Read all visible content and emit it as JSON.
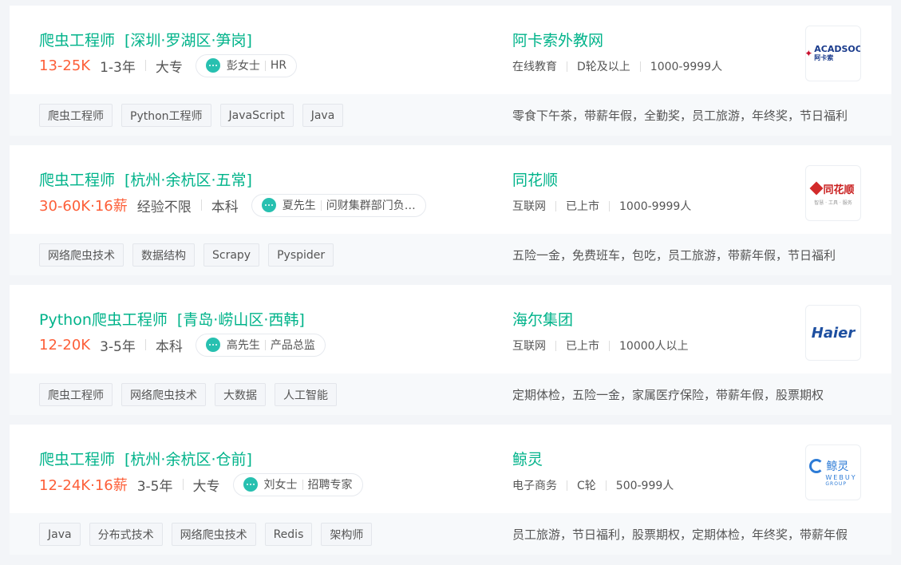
{
  "jobs": [
    {
      "title": "爬虫工程师",
      "location": "[深圳·罗湖区·笋岗]",
      "salary": "13-25K",
      "experience": "1-3年",
      "education": "大专",
      "hr_name": "彭女士",
      "hr_title": "HR",
      "company": "阿卡索外教网",
      "industry": "在线教育",
      "stage": "D轮及以上",
      "size": "1000-9999人",
      "logo": {
        "text": "ACADSOC",
        "sub": "阿卡索"
      },
      "tags": [
        "爬虫工程师",
        "Python工程师",
        "JavaScript",
        "Java"
      ],
      "benefits": "零食下午茶，带薪年假，全勤奖，员工旅游，年终奖，节日福利"
    },
    {
      "title": "爬虫工程师",
      "location": "[杭州·余杭区·五常]",
      "salary": "30-60K·16薪",
      "experience": "经验不限",
      "education": "本科",
      "hr_name": "夏先生",
      "hr_title": "问财集群部门负责人",
      "company": "同花顺",
      "industry": "互联网",
      "stage": "已上市",
      "size": "1000-9999人",
      "logo": {
        "text": "同花顺",
        "sub": "智慧 · 工具 · 服务"
      },
      "tags": [
        "网络爬虫技术",
        "数据结构",
        "Scrapy",
        "Pyspider"
      ],
      "benefits": "五险一金，免费班车，包吃，员工旅游，带薪年假，节日福利"
    },
    {
      "title": "Python爬虫工程师",
      "location": "[青岛·崂山区·西韩]",
      "salary": "12-20K",
      "experience": "3-5年",
      "education": "本科",
      "hr_name": "高先生",
      "hr_title": "产品总监",
      "company": "海尔集团",
      "industry": "互联网",
      "stage": "已上市",
      "size": "10000人以上",
      "logo": {
        "text": "Haier"
      },
      "tags": [
        "爬虫工程师",
        "网络爬虫技术",
        "大数据",
        "人工智能"
      ],
      "benefits": "定期体检，五险一金，家属医疗保险，带薪年假，股票期权"
    },
    {
      "title": "爬虫工程师",
      "location": "[杭州·余杭区·仓前]",
      "salary": "12-24K·16薪",
      "experience": "3-5年",
      "education": "大专",
      "hr_name": "刘女士",
      "hr_title": "招聘专家",
      "company": "鲸灵",
      "industry": "电子商务",
      "stage": "C轮",
      "size": "500-999人",
      "logo": {
        "text": "鲸灵",
        "sub": "WEBUY",
        "sub2": "GROUP"
      },
      "tags": [
        "Java",
        "分布式技术",
        "网络爬虫技术",
        "Redis",
        "架构师"
      ],
      "benefits": "员工旅游，节日福利，股票期权，定期体检，年终奖，带薪年假"
    }
  ],
  "colors": {
    "accent": "#00b38a",
    "salary": "#fd5f39",
    "chat": "#27c0b0"
  },
  "icons": {
    "hr_chat": "chat-bubble-icon"
  }
}
